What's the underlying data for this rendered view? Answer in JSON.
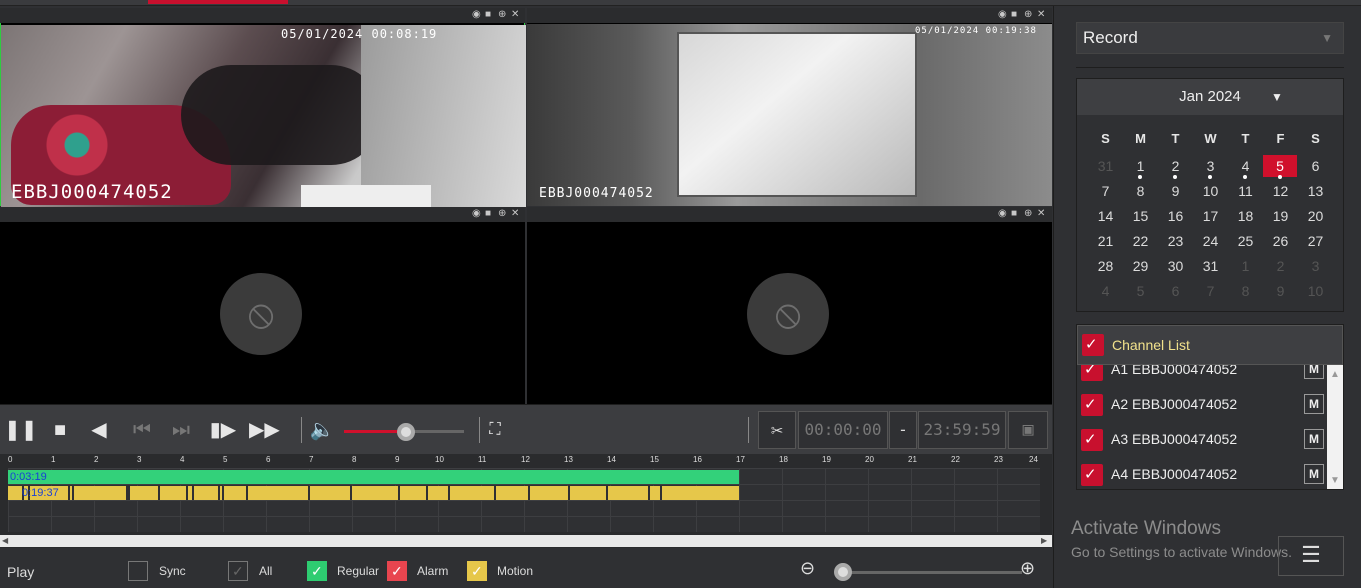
{
  "video": {
    "tile1": {
      "timestamp": "05/01/2024 00:08:19",
      "channel_name": "EBBJ000474052"
    },
    "tile2": {
      "timestamp": "05/01/2024 00:19:38",
      "channel_name": "EBBJ000474052"
    },
    "tile_icons": [
      "eye-icon",
      "camera-icon",
      "zoom-icon",
      "close-icon"
    ],
    "no_camera_icon": "camera-off-icon"
  },
  "controls": {
    "volume_level_percent": 52,
    "start_time": "00:00:00",
    "dash": "-",
    "end_time": "23:59:59"
  },
  "timeline": {
    "hours": [
      "0",
      "1",
      "2",
      "3",
      "4",
      "5",
      "6",
      "7",
      "8",
      "9",
      "10",
      "11",
      "12",
      "13",
      "14",
      "15",
      "16",
      "17",
      "18",
      "19",
      "20",
      "21",
      "22",
      "23",
      "24"
    ],
    "regular_label": "0:03:19",
    "motion_label": "0:19:37",
    "recorded_until_hour": 17,
    "colors": {
      "regular": "#33d17a",
      "motion": "#e6c74a",
      "alarm": "#e8454f"
    }
  },
  "bottom": {
    "play_label": "Play",
    "sync_label": "Sync",
    "all_label": "All",
    "regular_label": "Regular",
    "alarm_label": "Alarm",
    "motion_label": "Motion",
    "zoom_level_percent": 0
  },
  "sidebar": {
    "mode": "Record",
    "calendar": {
      "month_label": "Jan 2024",
      "weekdays": [
        "S",
        "M",
        "T",
        "W",
        "T",
        "F",
        "S"
      ],
      "weeks": [
        [
          "31",
          "1",
          "2",
          "3",
          "4",
          "5",
          "6"
        ],
        [
          "7",
          "8",
          "9",
          "10",
          "11",
          "12",
          "13"
        ],
        [
          "14",
          "15",
          "16",
          "17",
          "18",
          "19",
          "20"
        ],
        [
          "21",
          "22",
          "23",
          "24",
          "25",
          "26",
          "27"
        ],
        [
          "28",
          "29",
          "30",
          "31",
          "1",
          "2",
          "3"
        ],
        [
          "4",
          "5",
          "6",
          "7",
          "8",
          "9",
          "10"
        ]
      ],
      "selected_day": "5"
    },
    "channel_list": {
      "title": "Channel List",
      "items": [
        {
          "name": "A1 EBBJ000474052",
          "mode": "M"
        },
        {
          "name": "A2 EBBJ000474052",
          "mode": "M"
        },
        {
          "name": "A3 EBBJ000474052",
          "mode": "M"
        },
        {
          "name": "A4 EBBJ000474052",
          "mode": "M"
        }
      ]
    }
  },
  "watermark": {
    "title": "Activate Windows",
    "subtitle": "Go to Settings to activate Windows."
  }
}
